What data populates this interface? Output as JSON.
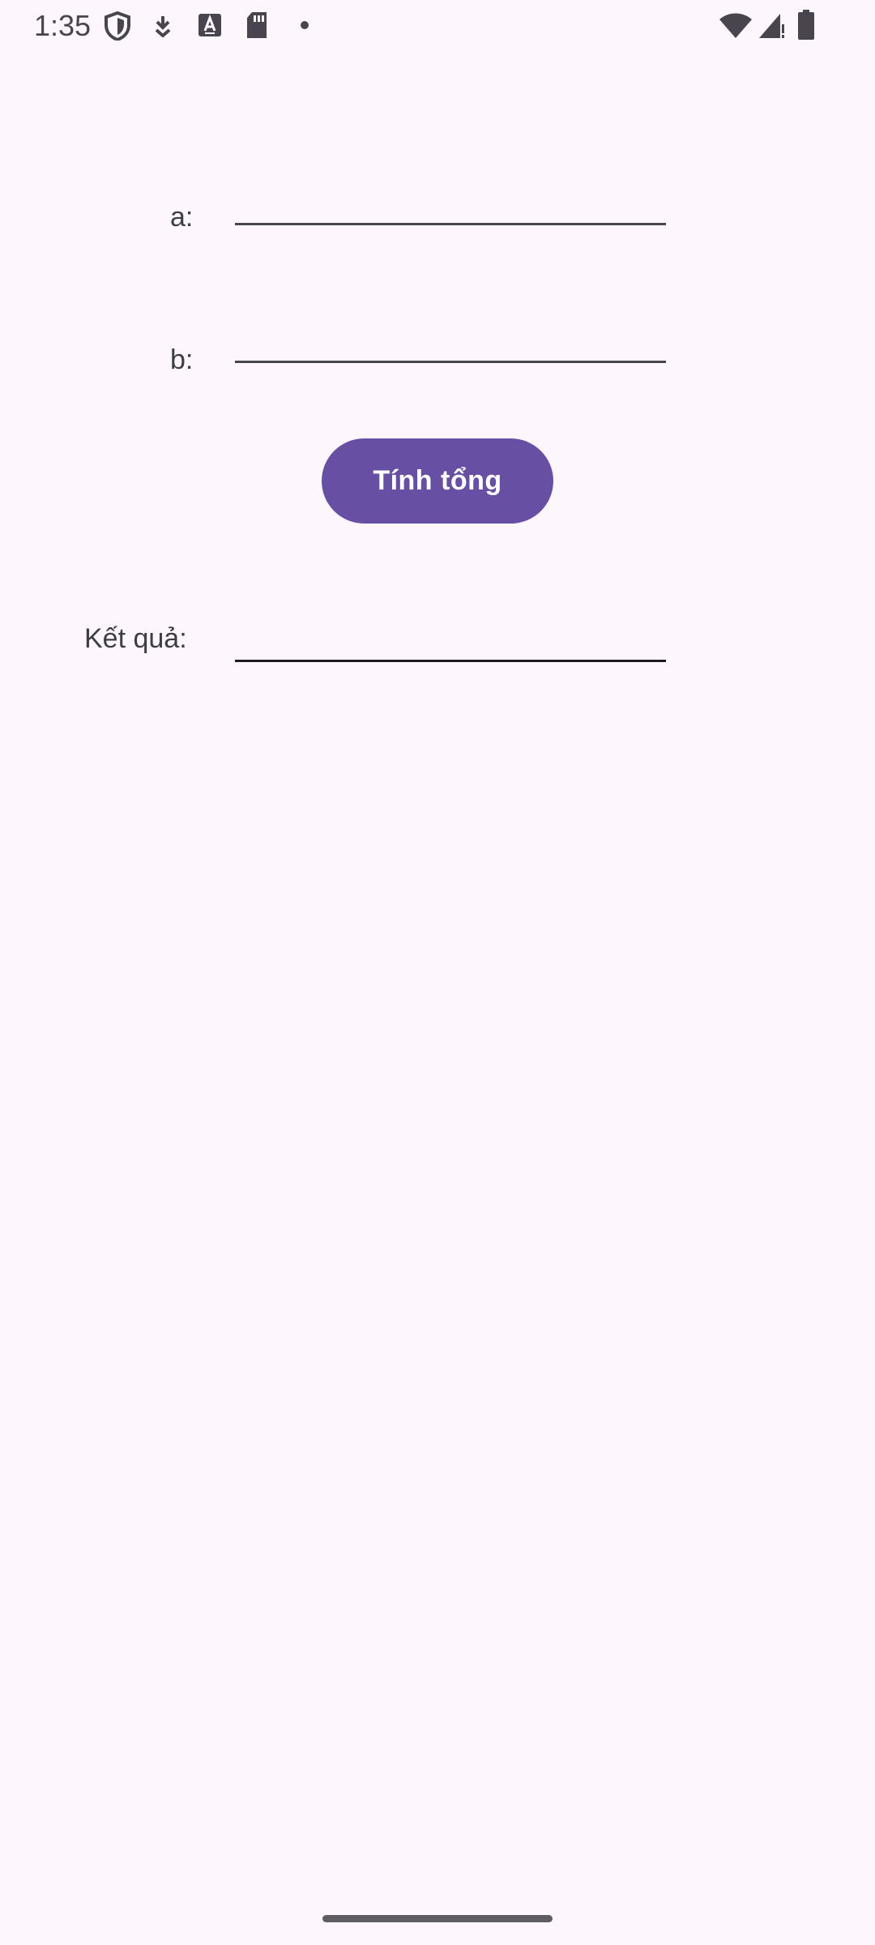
{
  "status_bar": {
    "time": "1:35",
    "left_icons": [
      "shield-icon",
      "download-icon",
      "keyboard-a-icon",
      "sd-card-icon",
      "dot-icon"
    ],
    "right_icons": [
      "wifi-icon",
      "cell-signal-icon",
      "battery-icon"
    ]
  },
  "form": {
    "field_a": {
      "label": "a:",
      "value": ""
    },
    "field_b": {
      "label": "b:",
      "value": ""
    },
    "sum_button_label": "Tính tổng",
    "result": {
      "label": "Kết quả:",
      "value": ""
    }
  },
  "colors": {
    "background": "#FDF7FD",
    "primary": "#6750A4",
    "text": "#3F3D44"
  }
}
